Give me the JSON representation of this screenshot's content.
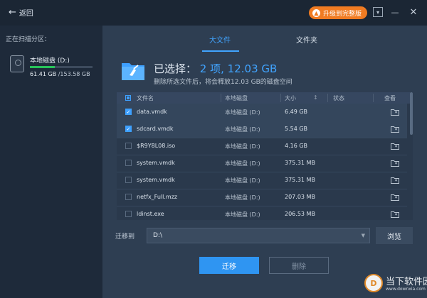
{
  "window": {
    "back_label": "返回",
    "upgrade_label": "升级到完整版"
  },
  "left": {
    "scan_label": "正在扫描分区：",
    "disk": {
      "name": "本地磁盘 (D:)",
      "used": "61.41 GB",
      "total": "/153.58 GB",
      "used_fraction": 0.4
    }
  },
  "tabs": [
    {
      "label": "大文件",
      "active": true
    },
    {
      "label": "文件夹",
      "active": false
    }
  ],
  "summary": {
    "prefix": "已选择：",
    "count": "2 项,",
    "size": "12.03 GB",
    "subtitle": "删除所选文件后，将会释放12.03 GB的磁盘空间"
  },
  "table": {
    "columns": [
      "文件名",
      "本地磁盘",
      "大小",
      "状态",
      "查看"
    ],
    "rows": [
      {
        "name": "data.vmdk",
        "disk": "本地磁盘 (D:)",
        "size": "6.49 GB",
        "checked": true
      },
      {
        "name": "sdcard.vmdk",
        "disk": "本地磁盘 (D:)",
        "size": "5.54 GB",
        "checked": true
      },
      {
        "name": "$R9Y8L08.iso",
        "disk": "本地磁盘 (D:)",
        "size": "4.16 GB",
        "checked": false
      },
      {
        "name": "system.vmdk",
        "disk": "本地磁盘 (D:)",
        "size": "375.31 MB",
        "checked": false
      },
      {
        "name": "system.vmdk",
        "disk": "本地磁盘 (D:)",
        "size": "375.31 MB",
        "checked": false
      },
      {
        "name": "netfx_Full.mzz",
        "disk": "本地磁盘 (D:)",
        "size": "207.03 MB",
        "checked": false
      },
      {
        "name": "ldinst.exe",
        "disk": "本地磁盘 (D:)",
        "size": "206.53 MB",
        "checked": false
      }
    ]
  },
  "destination": {
    "label": "迁移到",
    "value": "D:\\",
    "browse_label": "浏览"
  },
  "actions": {
    "migrate_label": "迁移",
    "delete_label": "删除"
  },
  "watermark": {
    "text": "当下软件园",
    "url": "www.downxia.com",
    "glyph": "D"
  },
  "colors": {
    "accent": "#41a4ff",
    "upgrade": "#f07b22",
    "progress": "#27c35a"
  }
}
